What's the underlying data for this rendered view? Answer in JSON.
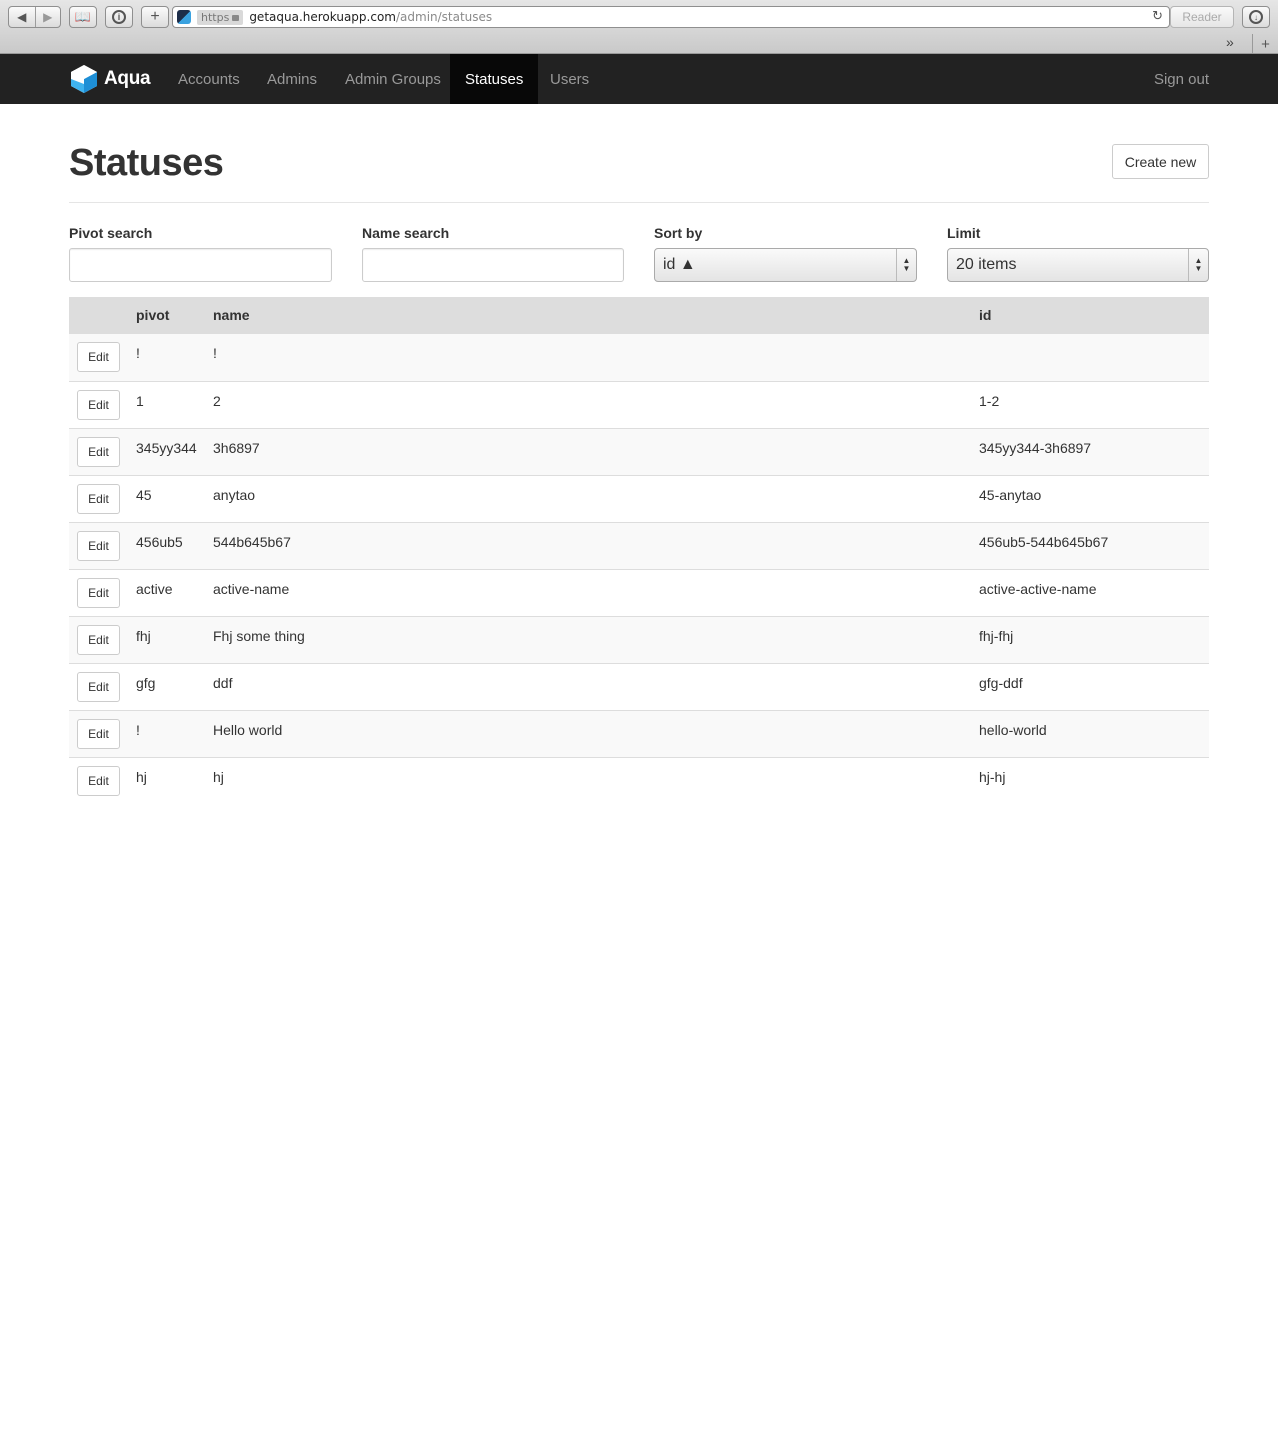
{
  "browser": {
    "url_scheme": "https",
    "url_host": "getaqua.herokuapp.com",
    "url_path": "/admin/statuses",
    "reader_label": "Reader",
    "icons": [
      "back-icon",
      "forward-icon",
      "bookmarks-icon",
      "info-icon",
      "add-icon",
      "reload-icon",
      "download-icon",
      "chevron-icon"
    ]
  },
  "navbar": {
    "brand": "Aqua",
    "items": [
      {
        "label": "Accounts",
        "active": false
      },
      {
        "label": "Admins",
        "active": false
      },
      {
        "label": "Admin Groups",
        "active": false
      },
      {
        "label": "Statuses",
        "active": true
      },
      {
        "label": "Users",
        "active": false
      }
    ],
    "signout_label": "Sign out"
  },
  "page": {
    "title": "Statuses",
    "create_label": "Create new"
  },
  "filters": {
    "pivot_label": "Pivot search",
    "pivot_value": "",
    "name_label": "Name search",
    "name_value": "",
    "sort_label": "Sort by",
    "sort_value": "id ▲",
    "limit_label": "Limit",
    "limit_value": "20 items"
  },
  "table": {
    "headers": {
      "pivot": "pivot",
      "name": "name",
      "id": "id"
    },
    "edit_label": "Edit",
    "rows": [
      {
        "pivot": "!",
        "name": "!",
        "id": ""
      },
      {
        "pivot": "1",
        "name": "2",
        "id": "1-2"
      },
      {
        "pivot": "345yy344",
        "name": "3h6897",
        "id": "345yy344-3h6897"
      },
      {
        "pivot": "45",
        "name": "anytao",
        "id": "45-anytao"
      },
      {
        "pivot": "456ub5",
        "name": "544b645b67",
        "id": "456ub5-544b645b67"
      },
      {
        "pivot": "active",
        "name": "active-name",
        "id": "active-active-name"
      },
      {
        "pivot": "fhj",
        "name": "Fhj some thing",
        "id": "fhj-fhj"
      },
      {
        "pivot": "gfg",
        "name": "ddf",
        "id": "gfg-ddf"
      },
      {
        "pivot": "!",
        "name": "Hello world",
        "id": "hello-world"
      },
      {
        "pivot": "hj",
        "name": "hj",
        "id": "hj-hj"
      }
    ]
  },
  "colors": {
    "navbar_bg": "#222222",
    "navbar_active_bg": "#080808",
    "table_header_bg": "#dddddd",
    "brand_accent": "#3aa2e0"
  }
}
